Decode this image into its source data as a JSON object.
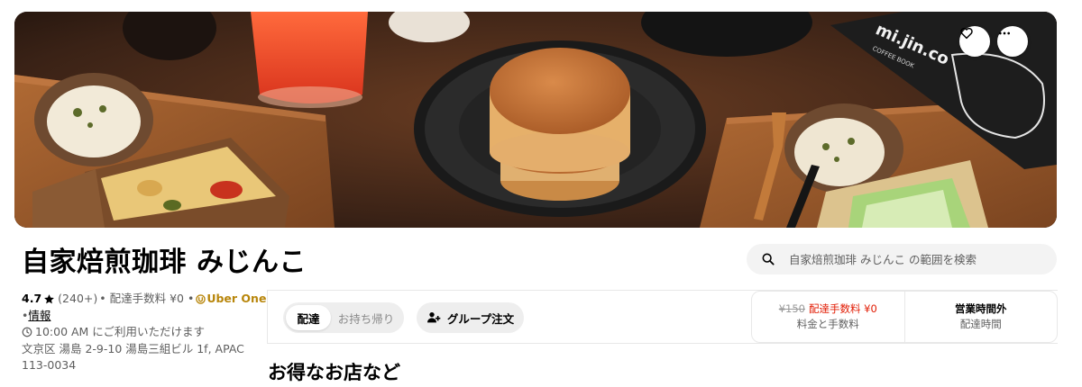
{
  "store": {
    "name": "自家焙煎珈琲 みじんこ",
    "rating": "4.7",
    "review_count": "(240+)",
    "delivery_fee_label": "• 配達手数料 ¥0 •",
    "uber_one": "Uber One",
    "info_prefix": "•",
    "info_link": "情報",
    "availability": "10:00 AM にご利用いただけます",
    "address_line1": "文京区 湯島 2-9-10 湯島三組ビル 1f, APAC",
    "address_line2": "113-0034"
  },
  "hero": {
    "notebook_text": "mi.jin.co",
    "notebook_sub": "COFFEE BOOK"
  },
  "search": {
    "placeholder": "自家焙煎珈琲 みじんこ の範囲を検索"
  },
  "mode_toggle": {
    "delivery": "配達",
    "pickup": "お持ち帰り",
    "selected": "配達"
  },
  "group_order": {
    "label": "グループ注文"
  },
  "fees": {
    "old_price": "¥150",
    "new_price": "配達手数料 ¥0",
    "caption": "料金と手数料"
  },
  "hours": {
    "status": "営業時間外",
    "caption": "配達時間"
  },
  "section": {
    "title": "お得なお店など"
  },
  "colors": {
    "accent_red": "#e11900",
    "uber_one_gold": "#b8860b",
    "muted_text": "#5e5e5e",
    "pill_bg": "#eeeeee"
  },
  "icons": {
    "favorite": "heart-icon",
    "more": "more-horizontal-icon",
    "search": "search-icon",
    "star": "star-icon",
    "clock": "clock-icon",
    "group": "group-add-icon"
  }
}
